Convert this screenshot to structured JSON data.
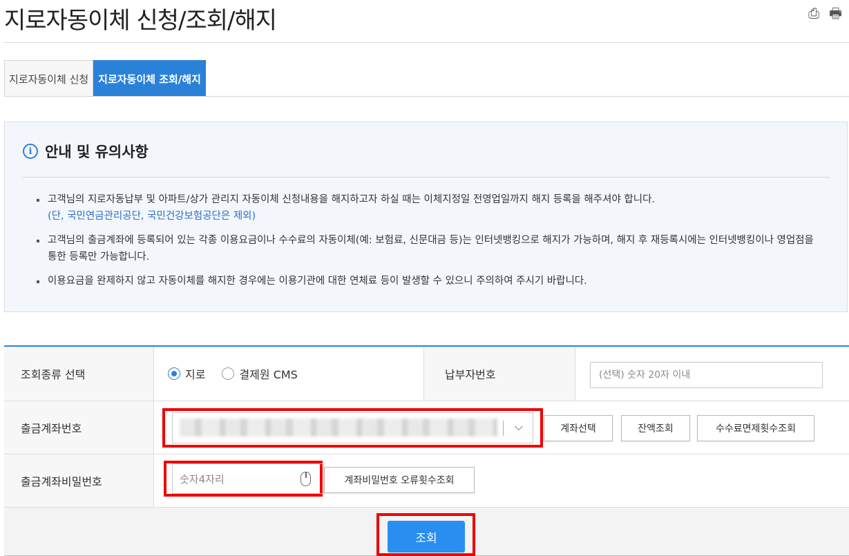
{
  "page": {
    "title": "지로자동이체 신청/조회/해지",
    "icons": {
      "save": "save-icon",
      "print": "print-icon"
    }
  },
  "tabs": [
    {
      "label": "지로자동이체 신청",
      "active": false
    },
    {
      "label": "지로자동이체 조회/해지",
      "active": true
    }
  ],
  "notice": {
    "title": "안내 및 유의사항",
    "items": [
      "고객님의 지로자동납부 및 아파트/상가 관리지 자동이체 신청내용을 해지하고자 하실 때는 이체지정일 전영업일까지 해지 등록을 해주셔야 합니다.",
      "고객님의 출금계좌에 등록되어 있는 각종 이용요금이나 수수료의 자동이체(예: 보험료, 신문대금 등)는 인터넷뱅킹으로 해지가 가능하며, 해지 후 재등록시에는 인터넷뱅킹이나 영업점을 통한 등록만 가능합니다.",
      "이용요금을 완제하지 않고 자동이체를 해지한 경우에는 이용기관에 대한 연체료 등이 발생할 수 있으니 주의하여 주시기 바랍니다."
    ],
    "note": "(단, 국민연금관리공단, 국민건강보험공단은 제외)"
  },
  "form": {
    "query_type": {
      "label": "조회종류 선택",
      "options": [
        "지로",
        "결제원 CMS"
      ],
      "selected": "지로"
    },
    "payer": {
      "label": "납부자번호",
      "placeholder": "(선택) 숫자 20자 이내"
    },
    "account": {
      "label": "출금계좌번호",
      "buttons": {
        "select": "계좌선택",
        "balance": "잔액조회",
        "fee": "수수료면제횟수조회"
      }
    },
    "password": {
      "label": "출금계좌비밀번호",
      "placeholder": "숫자4자리",
      "error_button": "계좌비밀번호 오류횟수조회"
    },
    "submit_label": "조회"
  },
  "colors": {
    "accent": "#2a81d8",
    "highlight": "#e00000"
  }
}
